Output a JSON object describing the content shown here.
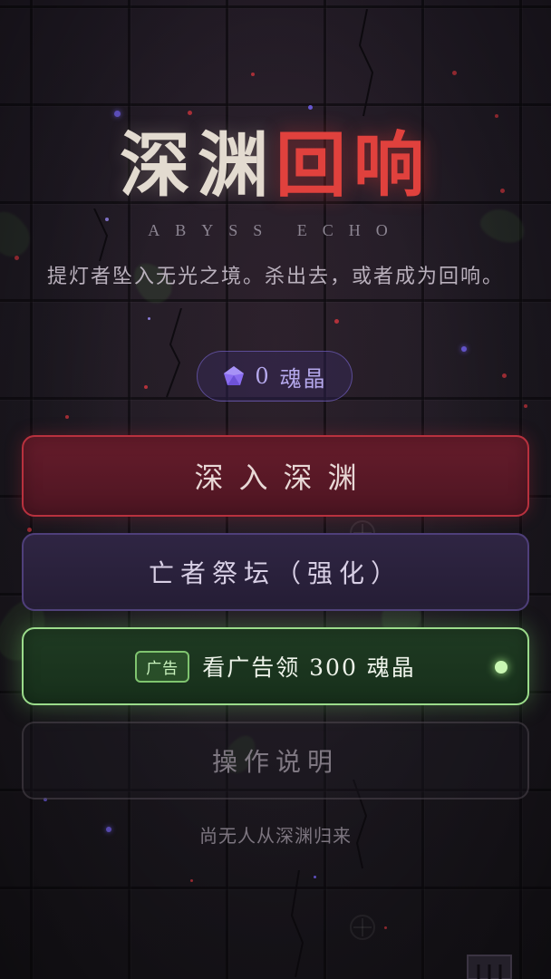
{
  "title": {
    "part1": "深渊",
    "part2": "回响",
    "subtitle_en": "ABYSS ECHO",
    "tagline": "提灯者坠入无光之境。杀出去，或者成为回响。"
  },
  "currency": {
    "icon": "soul-crystal-icon",
    "value": "0",
    "unit": "魂晶",
    "color": "#8a6cf0"
  },
  "menu": {
    "enter_label": "深入深渊",
    "altar_label": "亡者祭坛（强化）",
    "ad_badge": "广告",
    "ad_label": "看广告领 300 魂晶",
    "help_label": "操作说明"
  },
  "footer": {
    "record_text": "尚无人从深渊归来"
  },
  "colors": {
    "accent_red": "#e0413d",
    "accent_green": "#9bdc8b",
    "accent_purple": "#4f3f7a",
    "background": "#1e1a22"
  }
}
